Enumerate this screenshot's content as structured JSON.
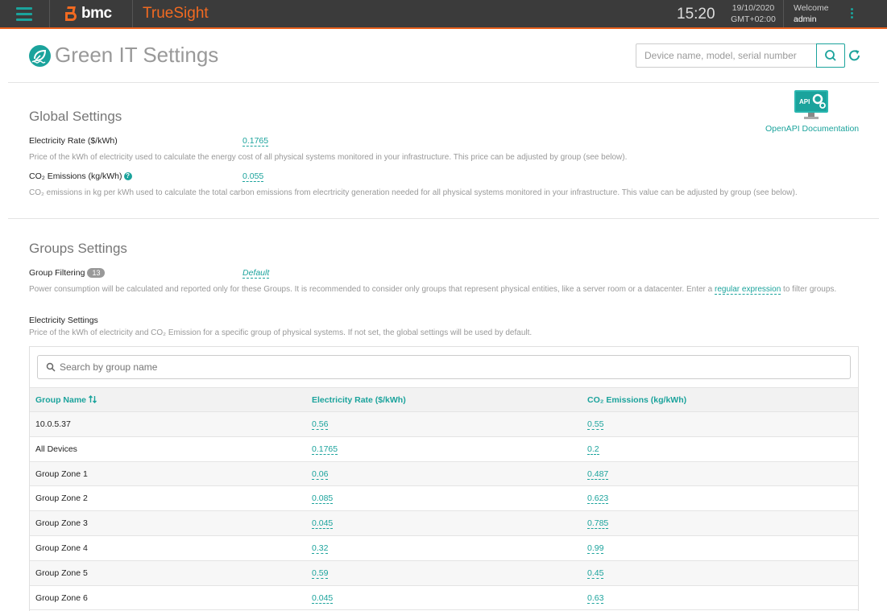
{
  "topbar": {
    "brand": "bmc",
    "product": "TrueSight",
    "time": "15:20",
    "date": "19/10/2020",
    "timezone": "GMT+02:00",
    "welcome": "Welcome",
    "user": "admin",
    "accent": "#1ba39c",
    "brand_color": "#f26a21"
  },
  "header": {
    "title": "Green IT Settings",
    "search_placeholder": "Device name, model, serial number",
    "api_link": "OpenAPI Documentation",
    "api_badge": "API"
  },
  "global": {
    "title": "Global Settings",
    "electricity_label": "Electricity Rate ($/kWh)",
    "electricity_value": "0.1765",
    "electricity_desc": "Price of the kWh of electricity used to calculate the energy cost of all physical systems monitored in your infrastructure. This price can be adjusted by group (see below).",
    "co2_label": "CO₂ Emissions (kg/kWh)",
    "co2_value": "0.055",
    "co2_desc": "CO₂ emissions in kg per kWh used to calculate the total carbon emissions from elecrtricity generation needed for all physical systems monitored in your infrastructure. This value can be adjusted by group (see below)."
  },
  "groups": {
    "title": "Groups Settings",
    "filter_label": "Group Filtering",
    "filter_count": "13",
    "filter_value": "Default",
    "filter_desc_pre": "Power consumption will be calculated and reported only for these Groups. It is recommended to consider only groups that represent physical entities, like a server room or a datacenter. Enter a",
    "filter_desc_link": "regular expression",
    "filter_desc_post": "to filter groups.",
    "electricity_title": "Electricity Settings",
    "electricity_desc": "Price of the kWh of electricity and CO₂ Emission for a specific group of physical systems. If not set, the global settings will be used by default.",
    "search_placeholder": "Search by group name",
    "columns": [
      "Group Name",
      "Electricity Rate ($/kWh)",
      "CO₂ Emissions (kg/kWh)"
    ],
    "rows": [
      {
        "name": "10.0.5.37",
        "rate": "0.56",
        "co2": "0.55"
      },
      {
        "name": "All Devices",
        "rate": "0.1765",
        "co2": "0.2"
      },
      {
        "name": "Group Zone 1",
        "rate": "0.06",
        "co2": "0.487"
      },
      {
        "name": "Group Zone 2",
        "rate": "0.085",
        "co2": "0.623"
      },
      {
        "name": "Group Zone 3",
        "rate": "0.045",
        "co2": "0.785"
      },
      {
        "name": "Group Zone 4",
        "rate": "0.32",
        "co2": "0.99"
      },
      {
        "name": "Group Zone 5",
        "rate": "0.59",
        "co2": "0.45"
      },
      {
        "name": "Group Zone 6",
        "rate": "0.045",
        "co2": "0.63"
      }
    ]
  }
}
